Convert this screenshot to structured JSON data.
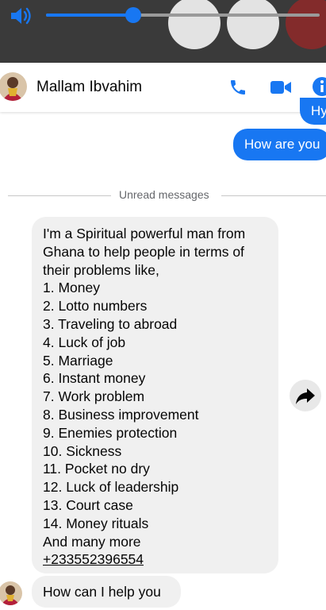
{
  "contact": {
    "name": "Mallam Ibvahim"
  },
  "outgoing": [
    {
      "text": "Hy"
    },
    {
      "text": "How are you"
    }
  ],
  "divider": {
    "label": "Unread messages"
  },
  "message": {
    "lines": [
      "I'm a Spiritual powerful man from",
      "Ghana to help people in terms of",
      "their problems like,",
      "1. Money",
      "2. Lotto numbers",
      "3. Traveling to abroad",
      "4. Luck of job",
      "5. Marriage",
      "6. Instant money",
      "7. Work problem",
      "8. Business improvement",
      "9. Enemies protection",
      "10. Sickness",
      "11. Pocket no dry",
      "12. Luck of leadership",
      "13. Court case",
      "14.  Money rituals",
      "And many more"
    ],
    "phone": "+233552396554"
  },
  "reply": {
    "text": "How can I help you"
  },
  "volume": {
    "level_percent": 32
  },
  "icons": {
    "volume": "speaker-icon",
    "call": "phone-icon",
    "video": "video-camera-icon",
    "info": "info-icon",
    "share": "forward-arrow-icon"
  },
  "colors": {
    "accent": "#1877f2",
    "bubble_in": "#f0f0f0",
    "text": "#050505"
  }
}
